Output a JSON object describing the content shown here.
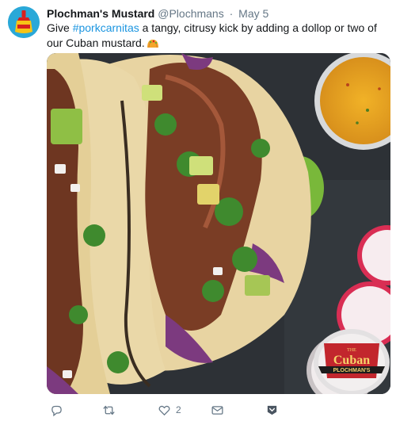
{
  "tweet": {
    "display_name": "Plochman's Mustard",
    "handle": "@Plochmans",
    "separator": "·",
    "time": "May 5",
    "text_before": "Give ",
    "hashtag": "#porkcarnitas",
    "text_after": " a tangy, citrusy kick by adding a dollop or two of our Cuban mustard."
  },
  "media": {
    "jar_label_top": "Cuban",
    "jar_label_bottom": "PLOCHMAN'S",
    "jar_label_small": "THE"
  },
  "actions": {
    "reply_count": "",
    "retweet_count": "",
    "like_count": "2"
  },
  "colors": {
    "hashtag": "#1b95e0",
    "muted": "#657786",
    "avatar_bg": "#2aa8d8"
  }
}
